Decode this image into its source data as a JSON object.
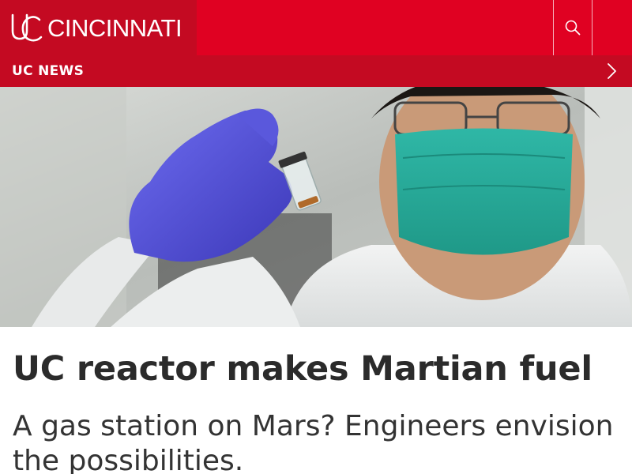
{
  "header": {
    "logo_text": "CINCINNATI",
    "brand_color": "#e00122",
    "dark_red": "#c40a22",
    "search_icon": "search-icon"
  },
  "section": {
    "title": "UC NEWS",
    "chevron_icon": "chevron-right-icon"
  },
  "hero": {
    "description_icon": "hero-photo"
  },
  "article": {
    "headline": "UC reactor makes Martian fuel",
    "subhead": "A gas station on Mars? Engineers envision the possibilities."
  }
}
